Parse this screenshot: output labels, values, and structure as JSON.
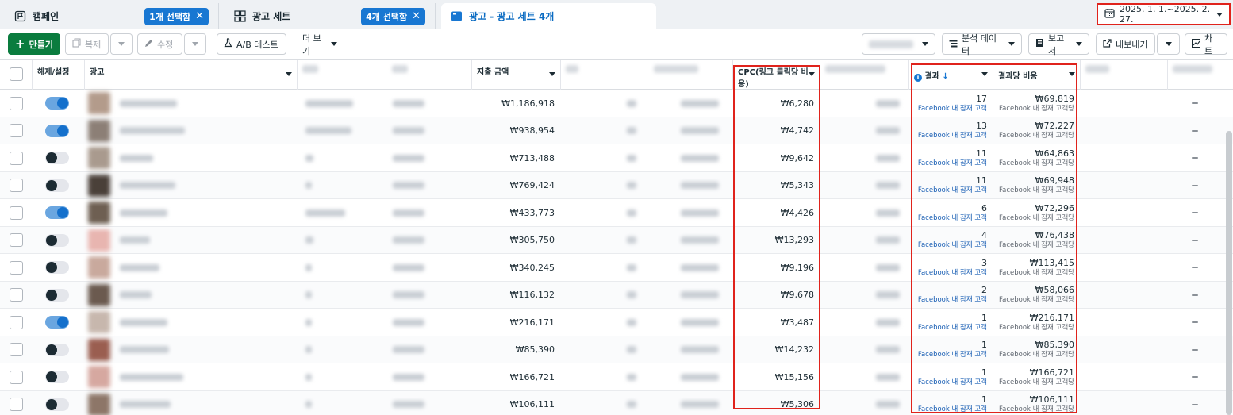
{
  "tabs": {
    "campaign": {
      "label": "캠페인",
      "chip": "1개 선택함"
    },
    "adset": {
      "label": "광고 세트",
      "chip": "4개 선택함"
    },
    "ads": {
      "label": "광고 - 광고 세트 4개"
    }
  },
  "date_range": "2025. 1. 1.~2025. 2. 27.",
  "toolbar": {
    "create": "만들기",
    "duplicate": "복제",
    "edit": "수정",
    "ab_test": "A/B 테스트",
    "more": "더 보기",
    "analyze": "분석 데이터",
    "reports": "보고서",
    "export": "내보내기",
    "chart": "차트"
  },
  "columns": {
    "toggle": "해제/설정",
    "ad": "광고",
    "spend": "지출 금액",
    "cpc": "CPC(링크 클릭당 비용)",
    "results": "결과",
    "cost_per_result": "결과당 비용"
  },
  "result_type": "Facebook 내 잠재 고객",
  "cost_per_result_type": "Facebook 내 잠재 고객당",
  "rows": [
    {
      "on": true,
      "spend": "₩1,186,918",
      "cpc": "₩6,280",
      "results": "17",
      "cpr": "₩69,819",
      "thumb": "#b39b8b"
    },
    {
      "on": true,
      "spend": "₩938,954",
      "cpc": "₩4,742",
      "results": "13",
      "cpr": "₩72,227",
      "thumb": "#8c7f76"
    },
    {
      "on": false,
      "spend": "₩713,488",
      "cpc": "₩9,642",
      "results": "11",
      "cpr": "₩64,863",
      "thumb": "#a99a8e"
    },
    {
      "on": false,
      "spend": "₩769,424",
      "cpc": "₩5,343",
      "results": "11",
      "cpr": "₩69,948",
      "thumb": "#4a4039"
    },
    {
      "on": true,
      "spend": "₩433,773",
      "cpc": "₩4,426",
      "results": "6",
      "cpr": "₩72,296",
      "thumb": "#6e5f52"
    },
    {
      "on": false,
      "spend": "₩305,750",
      "cpc": "₩13,293",
      "results": "4",
      "cpr": "₩76,438",
      "thumb": "#e8b5b0"
    },
    {
      "on": false,
      "spend": "₩340,245",
      "cpc": "₩9,196",
      "results": "3",
      "cpr": "₩113,415",
      "thumb": "#c9a99d"
    },
    {
      "on": false,
      "spend": "₩116,132",
      "cpc": "₩9,678",
      "results": "2",
      "cpr": "₩58,066",
      "thumb": "#6b5a4f"
    },
    {
      "on": true,
      "spend": "₩216,171",
      "cpc": "₩3,487",
      "results": "1",
      "cpr": "₩216,171",
      "thumb": "#c7b7ad"
    },
    {
      "on": false,
      "spend": "₩85,390",
      "cpc": "₩14,232",
      "results": "1",
      "cpr": "₩85,390",
      "thumb": "#9a5e50"
    },
    {
      "on": false,
      "spend": "₩166,721",
      "cpc": "₩15,156",
      "results": "1",
      "cpr": "₩166,721",
      "thumb": "#d6a8a0"
    },
    {
      "on": false,
      "spend": "₩106,111",
      "cpc": "₩5,306",
      "results": "1",
      "cpr": "₩106,111",
      "thumb": "#8d7668"
    }
  ],
  "icons": {
    "campaign": "flag-icon",
    "adset": "grid-icon",
    "ads": "ad-icon",
    "date": "calendar-icon"
  },
  "colors": {
    "primary": "#1877d2",
    "create": "#0a7c3e",
    "highlight": "#e0231c"
  }
}
